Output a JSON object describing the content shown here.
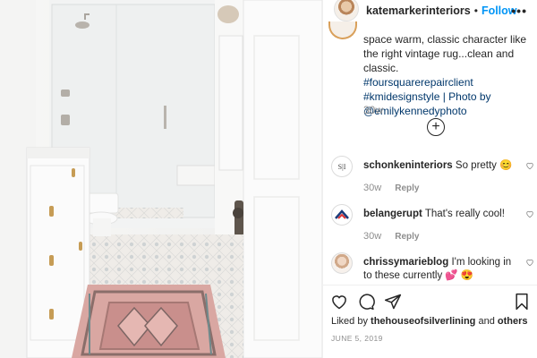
{
  "header": {
    "username": "katemarkerinteriors",
    "separator": "•",
    "follow_label": "Follow",
    "more_label": "•••"
  },
  "caption": {
    "text": "space warm, classic character like the right vintage rug...clean and classic.",
    "hashtags": [
      "#foursquarerepairclient",
      "#kmidesignstyle | Photo by",
      "@emilykennedyphoto"
    ],
    "time": "30w"
  },
  "load_more": {
    "icon": "plus-circle-icon",
    "label": "+"
  },
  "comments": [
    {
      "avatar_text": "S|I",
      "username": "schonkeninteriors",
      "text": "So pretty 😊",
      "time": "30w",
      "reply_label": "Reply"
    },
    {
      "avatar_text": "",
      "username": "belangerupt",
      "text": "That's really cool!",
      "time": "30w",
      "reply_label": "Reply"
    },
    {
      "avatar_text": "",
      "username": "chrissymarieblog",
      "text": "I'm looking in to these currently 💕 😍",
      "time": "",
      "reply_label": ""
    }
  ],
  "likes": {
    "prefix": "Liked by",
    "user": "thehouseofsilverlining",
    "connector": "and",
    "others": "others"
  },
  "date": "JUNE 5, 2019",
  "colors": {
    "follow": "#0095f6",
    "hashtag": "#00376b",
    "muted": "#8e8e8e",
    "text": "#262626"
  }
}
